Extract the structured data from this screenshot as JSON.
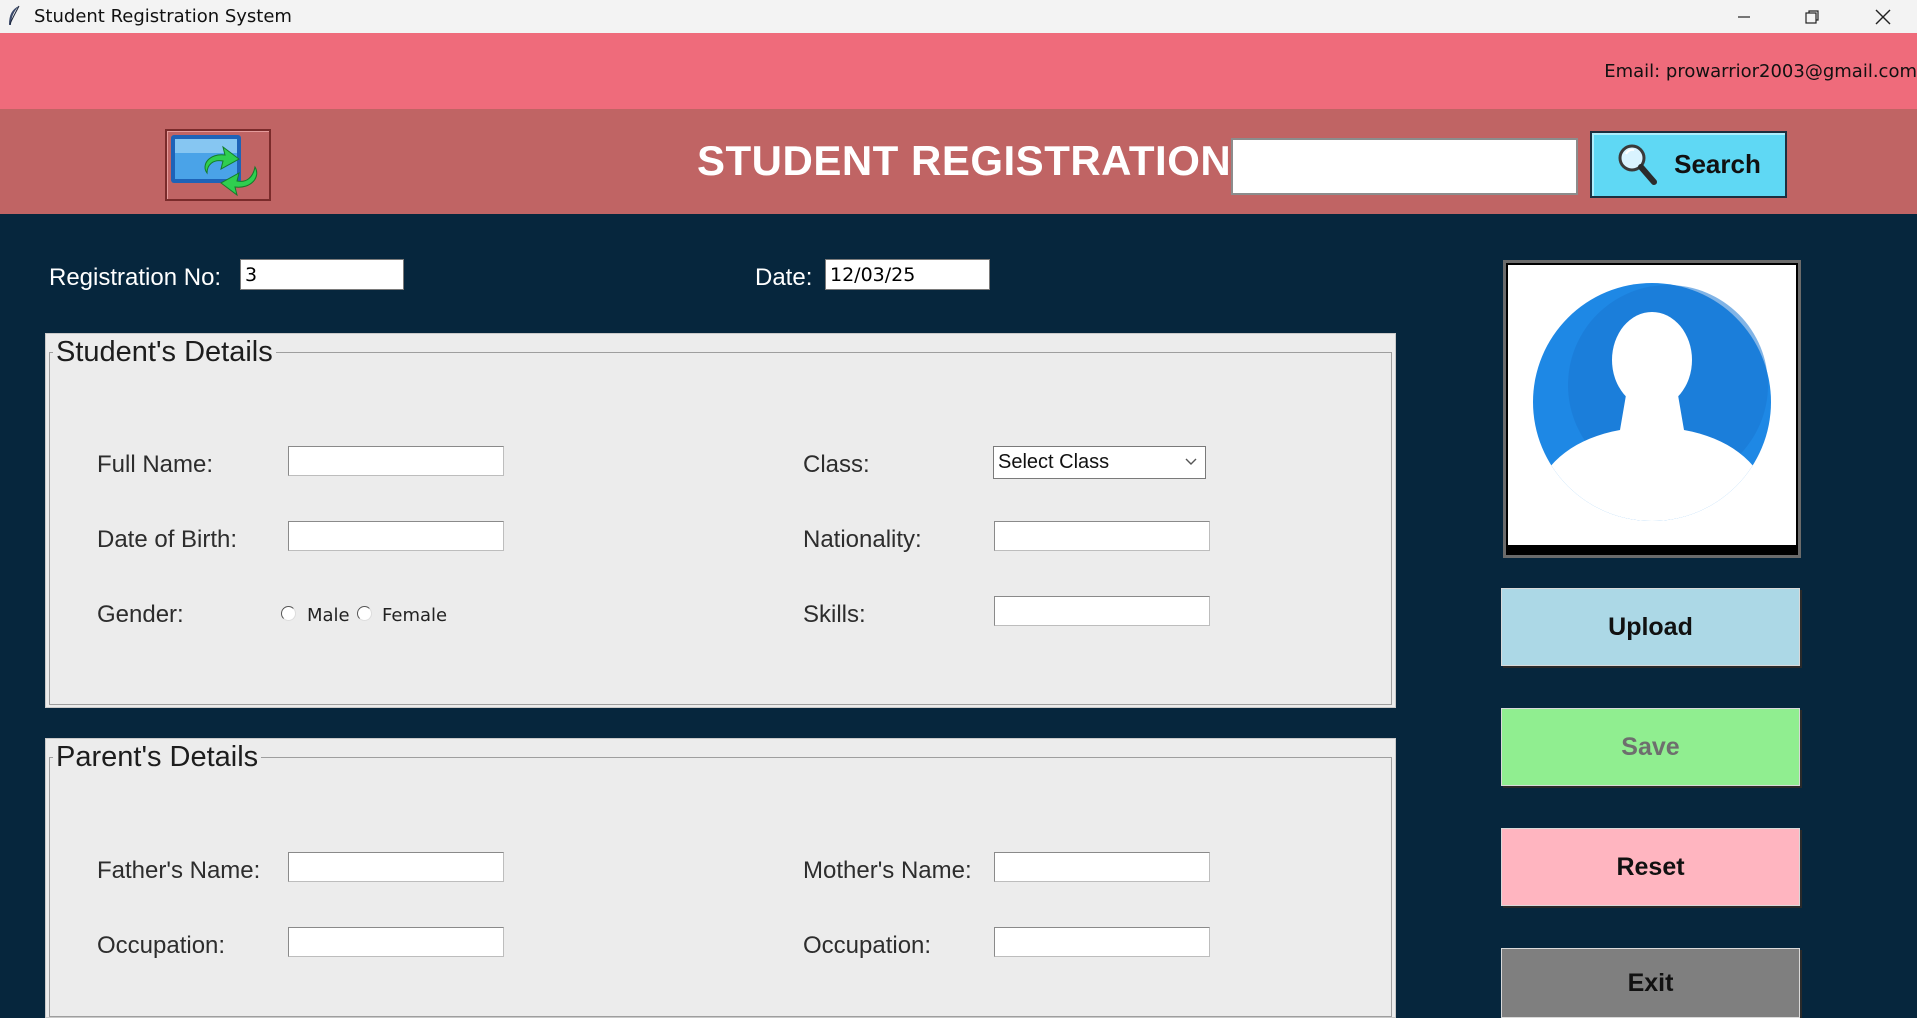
{
  "window": {
    "title": "Student Registration System"
  },
  "banner": {
    "email": "Email: prowarrior2003@gmail.com"
  },
  "header": {
    "title": "STUDENT REGISTRATION",
    "search_value": "",
    "search_label": "Search"
  },
  "registration": {
    "reg_label": "Registration No:",
    "reg_value": "3",
    "date_label": "Date:",
    "date_value": "12/03/25"
  },
  "student": {
    "section_title": "Student's Details",
    "full_name_label": "Full Name:",
    "dob_label": "Date of Birth:",
    "gender_label": "Gender:",
    "gender_options": [
      "Male",
      "Female"
    ],
    "class_label": "Class:",
    "class_selected": "Select Class",
    "nationality_label": "Nationality:",
    "skills_label": "Skills:"
  },
  "parent": {
    "section_title": "Parent's Details",
    "father_label": "Father's Name:",
    "father_occupation_label": "Occupation:",
    "mother_label": "Mother's Name:",
    "mother_occupation_label": "Occupation:"
  },
  "actions": {
    "upload": "Upload",
    "save": "Save",
    "reset": "Reset",
    "exit": "Exit"
  },
  "icons": {
    "app": "feather-icon",
    "refresh": "monitor-refresh-icon",
    "search": "magnifier-icon",
    "photo": "user-avatar-icon"
  },
  "colors": {
    "background": "#06263d",
    "banner": "#ef6b7b",
    "header": "#c06464",
    "search_button": "#5fd8f4",
    "upload": "#acd8e6",
    "save": "#90ee90",
    "reset": "#ffb5c0",
    "exit": "#7f7f7f"
  }
}
